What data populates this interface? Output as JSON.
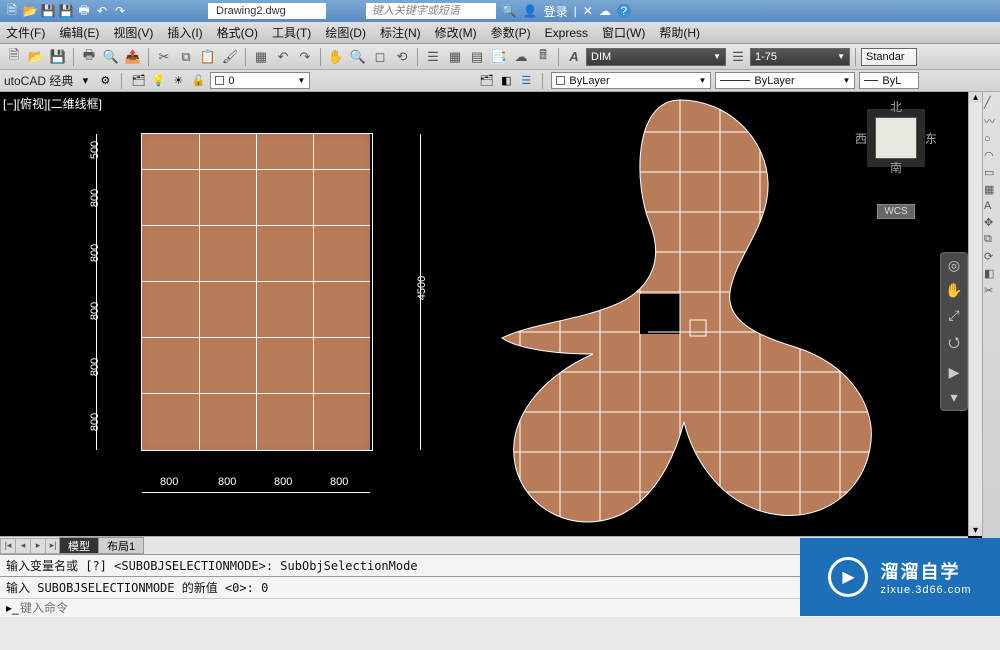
{
  "titlebar": {
    "filename": "Drawing2.dwg",
    "search_placeholder": "键入关键字或短语",
    "login": "登录"
  },
  "menus": [
    "文件(F)",
    "编辑(E)",
    "视图(V)",
    "插入(I)",
    "格式(O)",
    "工具(T)",
    "绘图(D)",
    "标注(N)",
    "修改(M)",
    "参数(P)",
    "Express",
    "窗口(W)",
    "帮助(H)"
  ],
  "toolbar1": {
    "dim_style": "DIM",
    "scale": "1-75",
    "text_style": "Standar"
  },
  "workspace": {
    "label": "utoCAD 经典",
    "layer_value": "0",
    "bylayer_color": "ByLayer",
    "bylayer_line": "ByLayer",
    "bylayer_weight": "ByL"
  },
  "viewport_label": "[−][俯视][二维线框]",
  "compass": {
    "n": "北",
    "s": "南",
    "e": "东",
    "w": "西",
    "wcs": "WCS"
  },
  "dimensions": {
    "total_height": "4500",
    "row_top": "500",
    "rows": [
      "800",
      "800",
      "800",
      "800",
      "800"
    ],
    "cols": [
      "800",
      "800",
      "800",
      "800"
    ]
  },
  "tabs": {
    "model": "模型",
    "layout1": "布局1"
  },
  "command": {
    "line1": "输入变量名或 [?] <SUBOBJSELECTIONMODE>: SubObjSelectionMode",
    "line2": "输入 SUBOBJSELECTIONMODE 的新值 <0>: 0",
    "prompt_placeholder": "键入命令"
  },
  "watermark": {
    "title": "溜溜自学",
    "url": "zixue.3d66.com"
  }
}
